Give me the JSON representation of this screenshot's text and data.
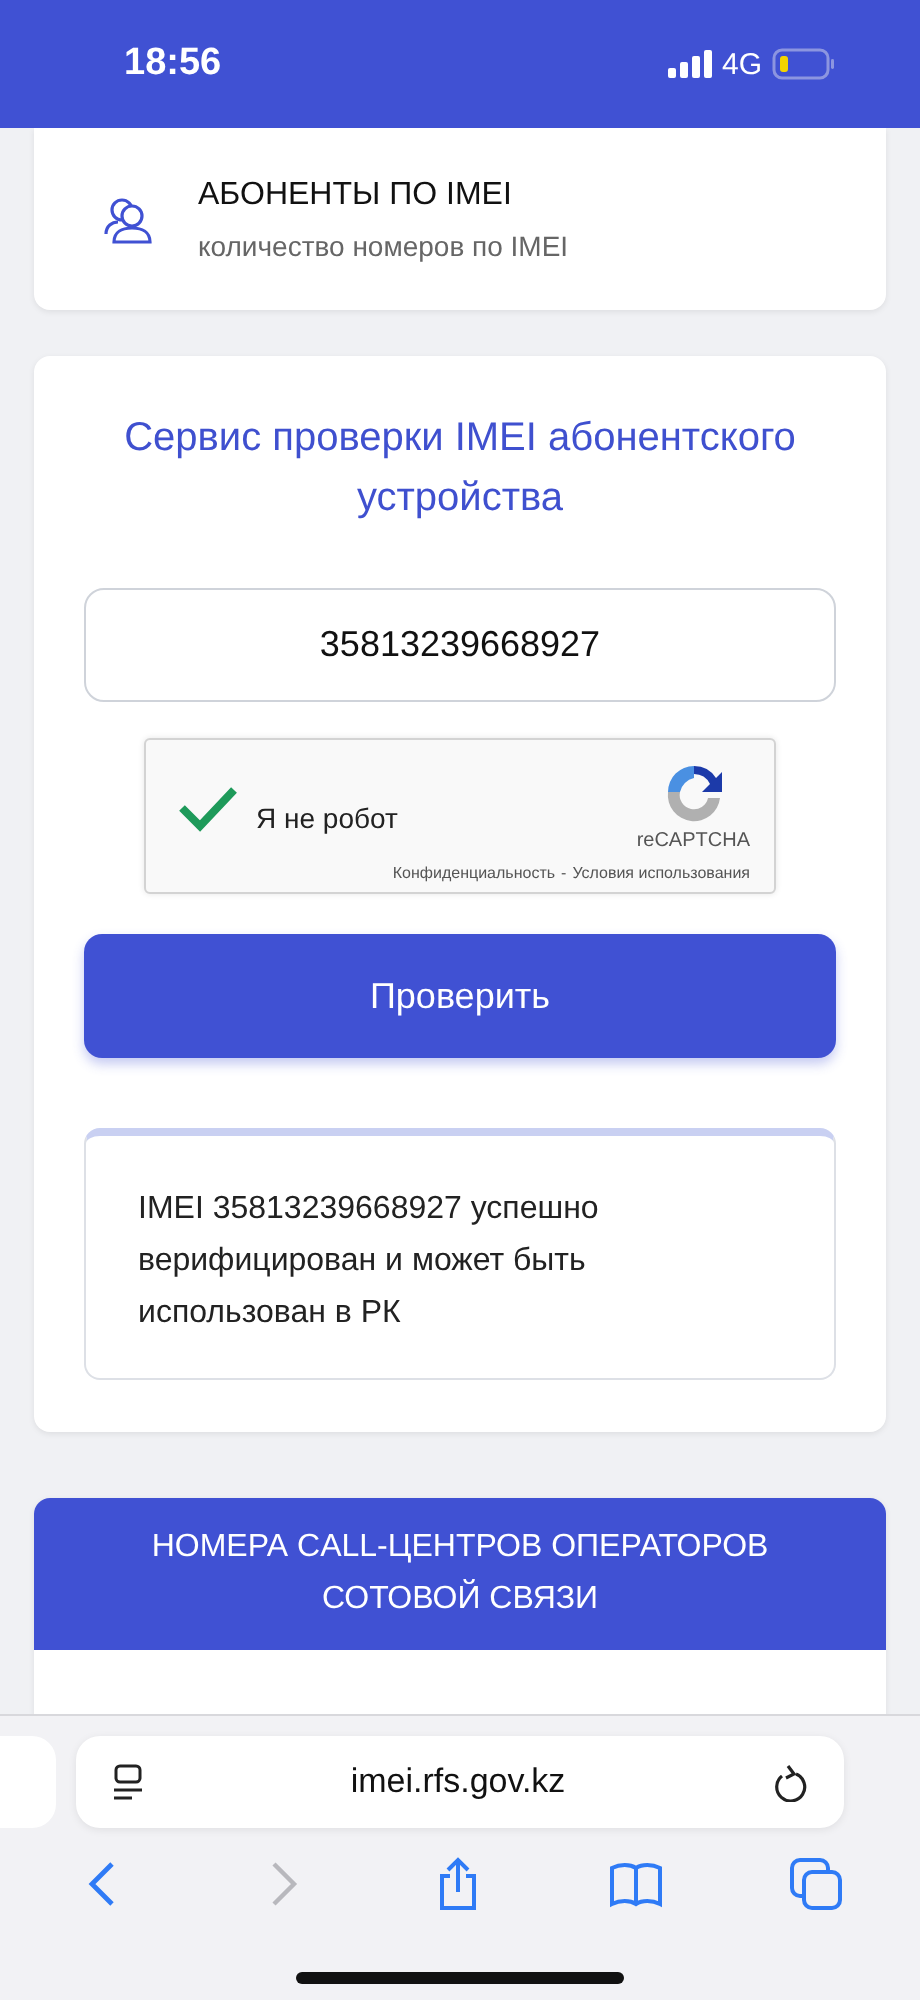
{
  "status_bar": {
    "time": "18:56",
    "network": "4G"
  },
  "subscribers_card": {
    "title": "АБОНЕНТЫ ПО IMEI",
    "subtitle": "количество номеров по IMEI"
  },
  "imei_check": {
    "title": "Сервис проверки IMEI абонентского устройства",
    "imei_value": "35813239668927",
    "captcha": {
      "checked": true,
      "label": "Я не робот",
      "brand": "reCAPTCHA",
      "privacy": "Конфиденциальность",
      "separator": "-",
      "terms": "Условия использования"
    },
    "button": "Проверить",
    "result": "IMEI 35813239668927 успешно верифицирован и может быть использован в РК"
  },
  "call_centers": {
    "title": "НОМЕРА CALL-ЦЕНТРОВ ОПЕРАТОРОВ СОТОВОЙ СВЯЗИ"
  },
  "browser": {
    "url": "imei.rfs.gov.kz"
  }
}
